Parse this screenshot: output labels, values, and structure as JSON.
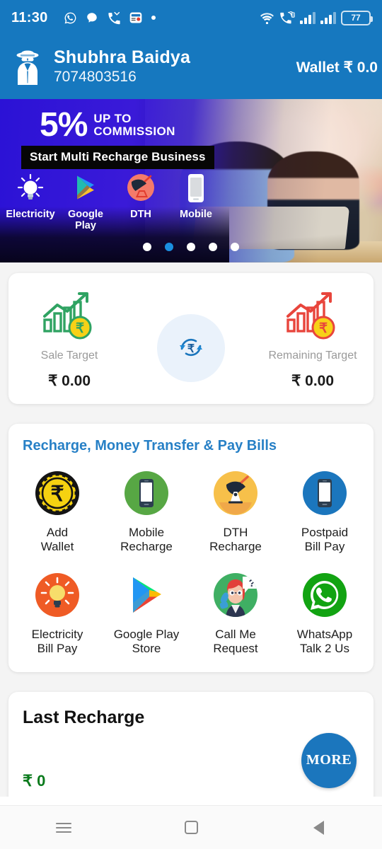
{
  "status_bar": {
    "time": "11:30",
    "left_icons": [
      "whatsapp-icon",
      "message-icon",
      "missed-call-icon",
      "app-notification-icon",
      "more-dot-icon"
    ],
    "right_icons": [
      "wifi-icon",
      "call-data-icon",
      "signal-bars-1-icon",
      "signal-bars-2-icon"
    ],
    "battery_level": "77"
  },
  "header": {
    "logo_icon": "detective-logo-icon",
    "user_name": "Shubhra Baidya",
    "user_phone": "7074803516",
    "wallet_label": "Wallet ₹ 0.0",
    "background_color": "#1678bf"
  },
  "banner": {
    "offer_percent": "5%",
    "offer_line1": "UP TO",
    "offer_line2": "COMMISSION",
    "strip_text": "Start Multi Recharge Business",
    "apps": [
      {
        "label": "Electricity",
        "icon": "bulb-icon"
      },
      {
        "label": "Google Play",
        "icon": "google-play-icon"
      },
      {
        "label": "DTH",
        "icon": "satellite-dish-icon"
      },
      {
        "label": "Mobile",
        "icon": "mobile-phone-icon"
      }
    ],
    "dots_total": 5,
    "dots_active_index": 1
  },
  "target": {
    "sale": {
      "label": "Sale Target",
      "value": "₹ 0.00",
      "icon": "growth-chart-green-icon",
      "color": "#2fa362"
    },
    "remaining": {
      "label": "Remaining Target",
      "value": "₹ 0.00",
      "icon": "growth-chart-red-icon",
      "color": "#e8453c"
    },
    "refresh_icon": "refresh-rupee-icon"
  },
  "services": {
    "title": "Recharge, Money Transfer & Pay Bills",
    "title_color": "#2780c6",
    "items": [
      {
        "line1": "Add",
        "line2": "Wallet",
        "icon": "rupee-coin-icon",
        "color": "#f5d211"
      },
      {
        "line1": "Mobile",
        "line2": "Recharge",
        "icon": "mobile-green-icon",
        "color": "#57a744"
      },
      {
        "line1": "DTH",
        "line2": "Recharge",
        "icon": "dth-dish-icon",
        "color": "#f7c04a"
      },
      {
        "line1": "Postpaid",
        "line2": "Bill Pay",
        "icon": "mobile-blue-icon",
        "color": "#1b76bd"
      },
      {
        "line1": "Electricity",
        "line2": "Bill Pay",
        "icon": "bulb-orange-icon",
        "color": "#ef5b25"
      },
      {
        "line1": "Google Play",
        "line2": "Store",
        "icon": "google-play-icon",
        "color": "#34a853"
      },
      {
        "line1": "Call Me",
        "line2": "Request",
        "icon": "support-agent-icon",
        "color": "#3faf63"
      },
      {
        "line1": "WhatsApp",
        "line2": "Talk 2 Us",
        "icon": "whatsapp-icon",
        "color": "#12a312"
      }
    ]
  },
  "last_recharge": {
    "title": "Last Recharge",
    "amount": "₹ 0",
    "more_label": "MORE",
    "amount_color": "#0a7a1c",
    "more_color": "#1b76bd"
  },
  "nav_bar": {
    "recents_icon": "menu-lines-icon",
    "home_icon": "home-square-icon",
    "back_icon": "back-triangle-icon"
  }
}
